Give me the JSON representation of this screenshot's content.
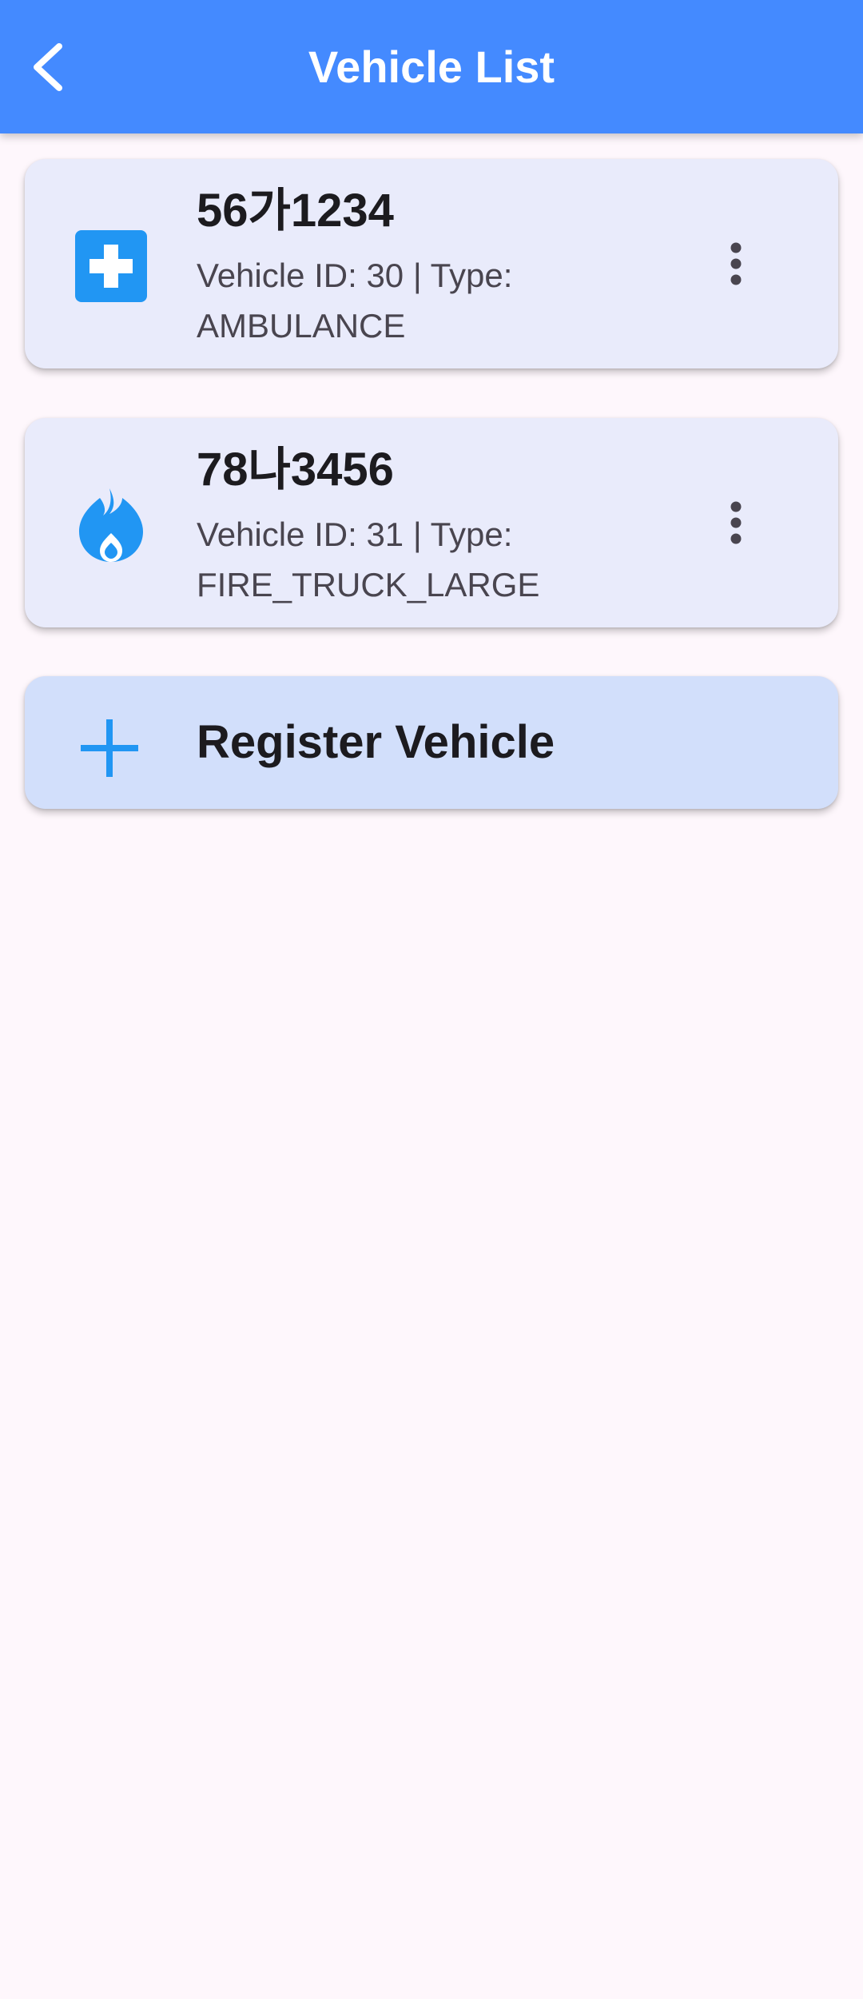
{
  "app_bar": {
    "title": "Vehicle List",
    "back_icon": "chevron-left-icon",
    "background_color": "#448AFF",
    "text_color": "#FFFFFF"
  },
  "vehicles": [
    {
      "plate": "56가1234",
      "details": "Vehicle ID: 30 | Type: AMBULANCE",
      "icon": "medical-cross-icon",
      "menu_icon": "more-vert-icon"
    },
    {
      "plate": "78나3456",
      "details": "Vehicle ID: 31 | Type: FIRE_TRUCK_LARGE",
      "icon": "fire-icon",
      "menu_icon": "more-vert-icon"
    }
  ],
  "register": {
    "label": "Register Vehicle",
    "icon": "add-icon"
  },
  "colors": {
    "accent": "#2196F3",
    "vehicle_card": "#E9EBFB",
    "register_card": "#D2DFFB",
    "page_background": "#FEF7FC"
  }
}
